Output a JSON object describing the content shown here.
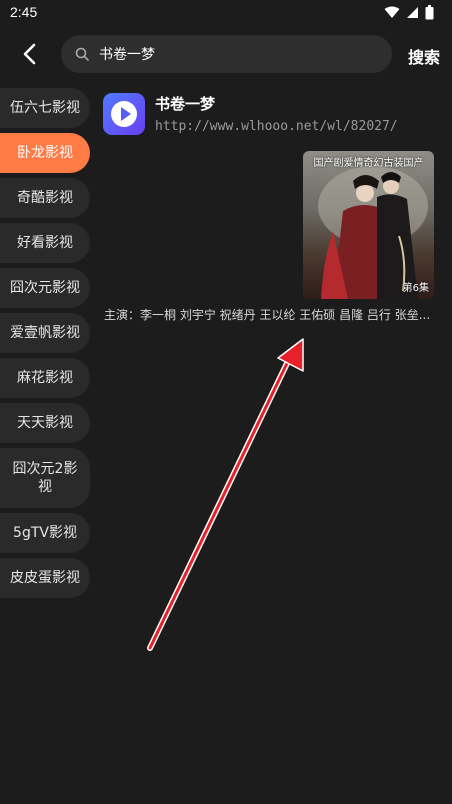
{
  "status_bar": {
    "time": "2:45"
  },
  "search": {
    "value": "书卷一梦",
    "button_label": "搜索"
  },
  "sidebar": {
    "items": [
      {
        "label": "伍六七影视",
        "active": false
      },
      {
        "label": "卧龙影视",
        "active": true
      },
      {
        "label": "奇酷影视",
        "active": false
      },
      {
        "label": "好看影视",
        "active": false
      },
      {
        "label": "囧次元影视",
        "active": false
      },
      {
        "label": "爱壹帆影视",
        "active": false
      },
      {
        "label": "麻花影视",
        "active": false
      },
      {
        "label": "天天影视",
        "active": false
      },
      {
        "label": "囧次元2影视",
        "active": false
      },
      {
        "label": "5gTV影视",
        "active": false
      },
      {
        "label": "皮皮蛋影视",
        "active": false
      }
    ]
  },
  "result": {
    "title": "书卷一梦",
    "url": "http://www.wlhooo.net/wl/82027/",
    "poster_tag": "国产剧爱情奇幻古装国产",
    "poster_episode": "第6集",
    "cast": "主演：李一桐 刘宇宁 祝绪丹 王以纶 王佑硕 昌隆 吕行 张垒..."
  },
  "colors": {
    "accent": "#ff7b45",
    "background": "#1c1c1c",
    "arrow": "#e8202a"
  }
}
